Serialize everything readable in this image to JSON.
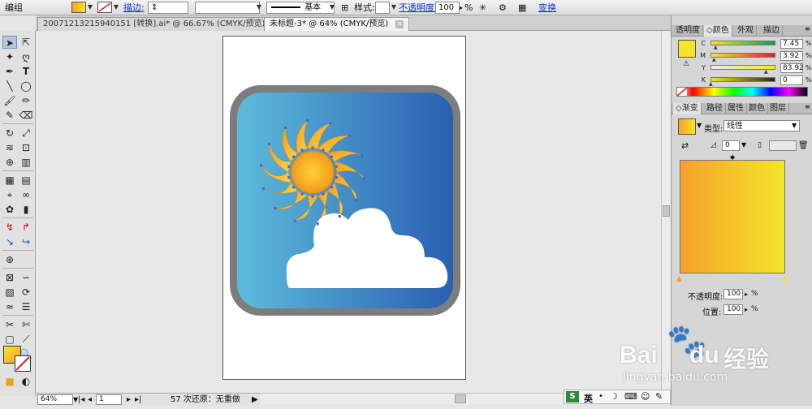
{
  "control_bar": {
    "group_label": "编组",
    "stroke_label": "描边:",
    "stroke_profile": "基本",
    "style_label": "样式:",
    "opacity_label": "不透明度:",
    "opacity_value": "100",
    "opacity_unit": "%",
    "transform_link": "变换"
  },
  "document_tabs": [
    {
      "label": "20071213215940151 [转换].ai* @ 66.67% (CMYK/预览)",
      "close": "×"
    },
    {
      "label": "未标题-3* @ 64% (CMYK/预览)",
      "close": "×"
    }
  ],
  "color_panel": {
    "tabs": [
      "透明度",
      "颜色",
      "外观",
      "描边"
    ],
    "channels": [
      {
        "name": "C",
        "value": "7.45",
        "unit": "%"
      },
      {
        "name": "M",
        "value": "3.92",
        "unit": "%"
      },
      {
        "name": "Y",
        "value": "83.92",
        "unit": "%"
      },
      {
        "name": "K",
        "value": "0",
        "unit": "%"
      }
    ]
  },
  "gradient_panel": {
    "tabs": [
      "渐变",
      "路径",
      "属性",
      "颜色",
      "图层"
    ],
    "type_label": "类型:",
    "type_value": "线性",
    "angle_value": "0",
    "opacity_label": "不透明度:",
    "opacity_value": "100",
    "location_label": "位置:",
    "location_value": "100",
    "unit": "%"
  },
  "status_bar": {
    "zoom": "64%",
    "page": "1",
    "undo_text": "57 次还原：无重做"
  },
  "watermark": {
    "brand": "Bai",
    "brand2": "du",
    "cn": "经验",
    "url": "jingyan.baidu.com"
  },
  "ime_bar": {
    "mode": "英"
  },
  "colors": {
    "fill_yellow": "#f5e42a",
    "fill_orange": "#f7a12c",
    "frame_gray": "#7d7d7d",
    "sky_light": "#5cbcdc",
    "sky_dark": "#2a5fb0",
    "sun_orange": "#f59a16",
    "sun_yellow": "#fcd74a",
    "link_blue": "#1535c8"
  }
}
